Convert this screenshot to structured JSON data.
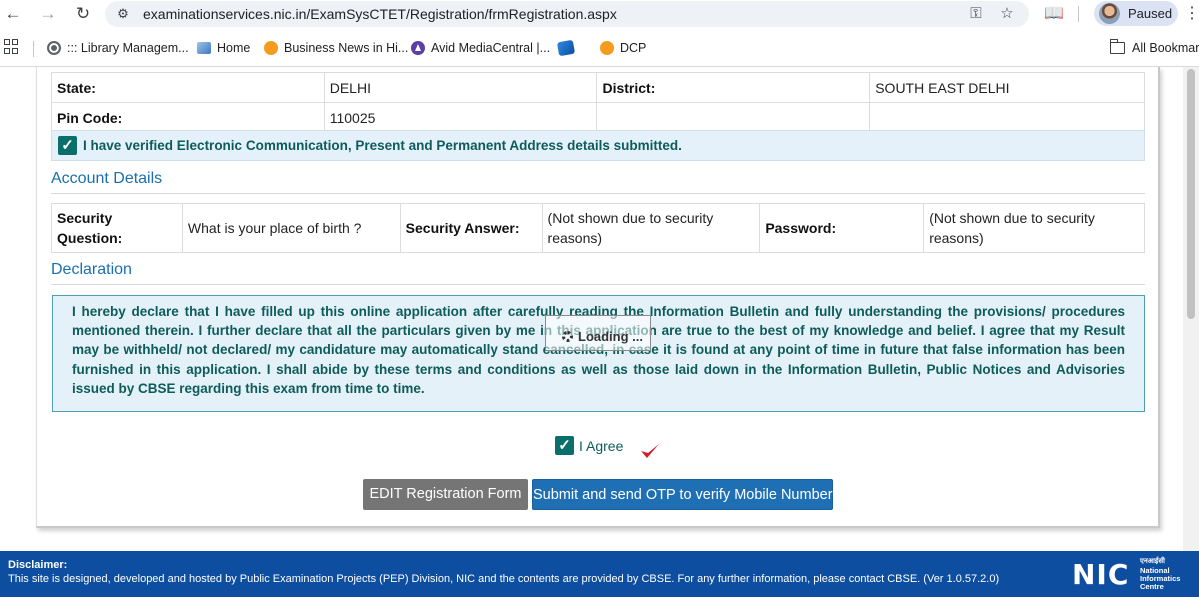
{
  "browser": {
    "url": "examinationservices.nic.in/ExamSysCTET/Registration/frmRegistration.aspx",
    "profile_label": "Paused",
    "bookmarks": [
      {
        "label": "::: Library Managem...",
        "icon": "globe-icon"
      },
      {
        "label": "Home",
        "icon": "chart-icon"
      },
      {
        "label": "Business News in Hi...",
        "icon": "orange-dot-icon"
      },
      {
        "label": "Avid MediaCentral |...",
        "icon": "avid-icon"
      },
      {
        "label": "",
        "icon": "shortcut-icon"
      },
      {
        "label": "DCP",
        "icon": "orange-dot-icon"
      }
    ],
    "all_bookmarks_label": "All Bookmarks"
  },
  "address": {
    "state_label": "State:",
    "state_value": "DELHI",
    "district_label": "District:",
    "district_value": "SOUTH EAST DELHI",
    "pincode_label": "Pin Code:",
    "pincode_value": "110025",
    "verified_text": "I have verified Electronic Communication, Present and Permanent Address details submitted."
  },
  "account": {
    "title": "Account Details",
    "security_question_label": "Security Question:",
    "security_question_value": "What is your place of birth ?",
    "security_answer_label": "Security Answer:",
    "security_answer_value": "(Not shown due to security reasons)",
    "password_label": "Password:",
    "password_value": "(Not shown due to security reasons)"
  },
  "declaration": {
    "title": "Declaration",
    "text": "I hereby declare that I have filled up this online application after carefully reading the Information Bulletin and fully understanding the provisions/ procedures mentioned therein. I further declare that all the particulars given by me in this application are true to the best of my knowledge and belief. I agree that my Result may be withheld/ not declared/ my candidature may automatically stand cancelled, in case it is found at any point of time in future that false information has been furnished in this application. I shall abide by these terms and conditions as well as those laid down in the Information Bulletin, Public Notices and Advisories issued by CBSE regarding this exam from time to time.",
    "agree_label": "I Agree",
    "agree_checked": true
  },
  "loading": {
    "text": "Loading ..."
  },
  "buttons": {
    "edit_label": "EDIT Registration Form",
    "submit_label": "Submit and send OTP to verify Mobile Number"
  },
  "footer": {
    "title": "Disclaimer:",
    "text": "This site is designed, developed and hosted by Public Examination Projects (PEP) Division, NIC and the contents are provided by CBSE. For any further information, please contact CBSE. (Ver 1.0.57.2.0)",
    "logo_text": "NIC",
    "logo_hindi": "एनआईसी",
    "logo_line1": "National",
    "logo_line2": "Informatics",
    "logo_line3": "Centre"
  },
  "colors": {
    "accent_blue": "#1f6fb5",
    "teal_text": "#0d5c5a",
    "footer_bg": "#0d4ea0",
    "declaration_bg": "#e5f1f9"
  }
}
